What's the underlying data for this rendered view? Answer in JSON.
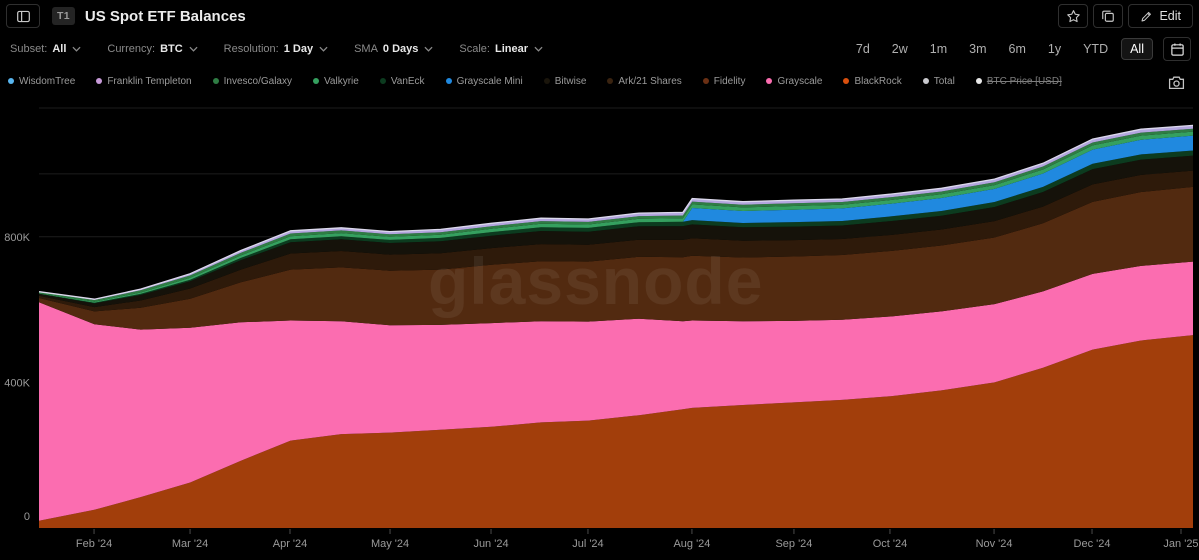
{
  "header": {
    "badge": "T1",
    "title": "US Spot ETF Balances",
    "edit_label": "Edit"
  },
  "filters": [
    {
      "key": "subset",
      "label": "Subset:",
      "value": "All"
    },
    {
      "key": "currency",
      "label": "Currency:",
      "value": "BTC"
    },
    {
      "key": "resolution",
      "label": "Resolution:",
      "value": "1 Day"
    },
    {
      "key": "sma",
      "label": "SMA",
      "value": "0 Days"
    },
    {
      "key": "scale",
      "label": "Scale:",
      "value": "Linear"
    }
  ],
  "ranges": {
    "options": [
      "7d",
      "2w",
      "1m",
      "3m",
      "6m",
      "1y",
      "YTD",
      "All"
    ],
    "selected": "All"
  },
  "legend": [
    {
      "name": "WisdomTree",
      "color": "#58b6f0",
      "struck": false
    },
    {
      "name": "Franklin Templeton",
      "color": "#c89bd9",
      "struck": false
    },
    {
      "name": "Invesco/Galaxy",
      "color": "#2f7d44",
      "struck": false
    },
    {
      "name": "Valkyrie",
      "color": "#35a05f",
      "struck": false
    },
    {
      "name": "VanEck",
      "color": "#0c3b1f",
      "struck": false
    },
    {
      "name": "Grayscale Mini",
      "color": "#2089df",
      "struck": false
    },
    {
      "name": "Bitwise",
      "color": "#1a150b",
      "struck": false
    },
    {
      "name": "Ark/21 Shares",
      "color": "#3a2310",
      "struck": false
    },
    {
      "name": "Fidelity",
      "color": "#6b3014",
      "struck": false
    },
    {
      "name": "Grayscale",
      "color": "#fb6db0",
      "struck": false
    },
    {
      "name": "BlackRock",
      "color": "#d9500e",
      "struck": false
    },
    {
      "name": "Total",
      "color": "#c9c9ce",
      "struck": false
    },
    {
      "name": "BTC Price [USD]",
      "color": "#e8e8e8",
      "struck": true
    }
  ],
  "watermark": "glassnode",
  "chart_data": {
    "type": "area",
    "stacked": true,
    "values_unit": "thousand BTC (axis K)",
    "ylim": [
      0,
      1200
    ],
    "grid": true,
    "y_ticks": [
      {
        "label": "0",
        "value": 0
      },
      {
        "label": "400K",
        "value": 400
      },
      {
        "label": "800K",
        "value": 800
      }
    ],
    "extra_gridline_values": [
      973,
      1154
    ],
    "x_ticks": [
      {
        "label": "Feb '24",
        "t": 0.0477
      },
      {
        "label": "Mar '24",
        "t": 0.1309
      },
      {
        "label": "Apr '24",
        "t": 0.2175
      },
      {
        "label": "May '24",
        "t": 0.3042
      },
      {
        "label": "Jun '24",
        "t": 0.3917
      },
      {
        "label": "Jul '24",
        "t": 0.4757
      },
      {
        "label": "Aug '24",
        "t": 0.5658
      },
      {
        "label": "Sep '24",
        "t": 0.6542
      },
      {
        "label": "Oct '24",
        "t": 0.7374
      },
      {
        "label": "Nov '24",
        "t": 0.8276
      },
      {
        "label": "Dec '24",
        "t": 0.9125
      },
      {
        "label": "Jan '25",
        "t": 0.9896
      }
    ],
    "x_fraction": [
      0,
      0.048,
      0.088,
      0.131,
      0.175,
      0.218,
      0.262,
      0.304,
      0.348,
      0.392,
      0.435,
      0.476,
      0.52,
      0.558,
      0.566,
      0.61,
      0.654,
      0.696,
      0.738,
      0.782,
      0.828,
      0.87,
      0.913,
      0.955,
      1.0
    ],
    "series": [
      {
        "name": "BlackRock",
        "color": "#a23e0b",
        "values": [
          20,
          50,
          85,
          125,
          185,
          240,
          258,
          262,
          270,
          278,
          290,
          295,
          310,
          326,
          330,
          338,
          345,
          352,
          362,
          378,
          400,
          440,
          490,
          515,
          530
        ]
      },
      {
        "name": "Grayscale",
        "color": "#fb6db0",
        "values": [
          600,
          510,
          460,
          425,
          380,
          330,
          310,
          295,
          288,
          285,
          278,
          272,
          265,
          242,
          240,
          230,
          224,
          220,
          219,
          217,
          215,
          210,
          208,
          205,
          202
        ]
      },
      {
        "name": "Fidelity",
        "color": "#522a10",
        "values": [
          12,
          35,
          60,
          80,
          110,
          140,
          148,
          150,
          152,
          160,
          165,
          165,
          170,
          176,
          178,
          175,
          177,
          178,
          180,
          181,
          183,
          187,
          198,
          203,
          205
        ]
      },
      {
        "name": "Ark/21 Shares",
        "color": "#2e1a0a",
        "values": [
          6,
          12,
          20,
          28,
          35,
          44,
          45,
          44,
          45,
          46,
          47,
          46,
          47,
          47.5,
          48,
          46,
          45,
          44,
          44,
          44,
          45,
          46,
          48,
          47,
          45
        ]
      },
      {
        "name": "Bitwise",
        "color": "#15120a",
        "values": [
          5,
          10,
          15,
          20,
          26,
          31,
          32,
          32,
          33,
          34,
          36,
          36,
          37,
          37.8,
          38,
          37,
          37,
          37,
          38,
          38,
          39,
          40,
          42,
          42,
          41
        ]
      },
      {
        "name": "VanEck",
        "color": "#0c3b1f",
        "values": [
          1,
          2,
          3,
          4,
          6,
          8,
          8.5,
          8.5,
          9,
          10,
          10.5,
          10.5,
          11,
          11.8,
          12,
          12,
          12.5,
          12.5,
          13,
          13,
          13.5,
          14,
          14.5,
          14.5,
          14
        ]
      },
      {
        "name": "Grayscale Mini",
        "color": "#2089df",
        "values": [
          0,
          0,
          0,
          0,
          0,
          0,
          0,
          0,
          0,
          0,
          0,
          0,
          0,
          0,
          33,
          33,
          34,
          34.5,
          35,
          35.5,
          36,
          37,
          39,
          40,
          41
        ]
      },
      {
        "name": "Valkyrie",
        "color": "#35a05f",
        "values": [
          1,
          2.5,
          4,
          5.5,
          7,
          8.5,
          8.8,
          8.5,
          8.7,
          9,
          9.2,
          9.2,
          9.5,
          9.9,
          10,
          9.8,
          10,
          10,
          10.2,
          10.3,
          10.5,
          11,
          11.5,
          11.5,
          11
        ]
      },
      {
        "name": "Invesco/Galaxy",
        "color": "#2f7d44",
        "values": [
          3,
          5,
          6,
          6.5,
          7,
          7.5,
          7.2,
          7,
          7,
          7.2,
          7.3,
          7.2,
          7.4,
          7.55,
          7.6,
          7.4,
          7.5,
          7.5,
          7.6,
          7.7,
          7.8,
          8,
          8.2,
          8.2,
          8
        ]
      },
      {
        "name": "Franklin Templeton",
        "color": "#b3a6de",
        "values": [
          1,
          2,
          3,
          4.5,
          6,
          7,
          7,
          7,
          7.2,
          7.5,
          7.6,
          7.6,
          7.8,
          7.95,
          8,
          7.9,
          8,
          8,
          8.1,
          8.2,
          8.3,
          8.5,
          8.8,
          8.8,
          8.6
        ]
      },
      {
        "name": "WisdomTree",
        "color": "#58b6f0",
        "values": [
          0.1,
          0.15,
          0.2,
          0.25,
          0.3,
          0.35,
          0.35,
          0.35,
          0.35,
          0.4,
          0.4,
          0.4,
          0.4,
          0.44,
          0.45,
          0.45,
          0.45,
          0.45,
          0.45,
          0.5,
          0.5,
          0.5,
          0.5,
          0.5,
          0.5
        ]
      }
    ],
    "total_line": {
      "name": "Total",
      "color": "#dcd9ec"
    }
  }
}
